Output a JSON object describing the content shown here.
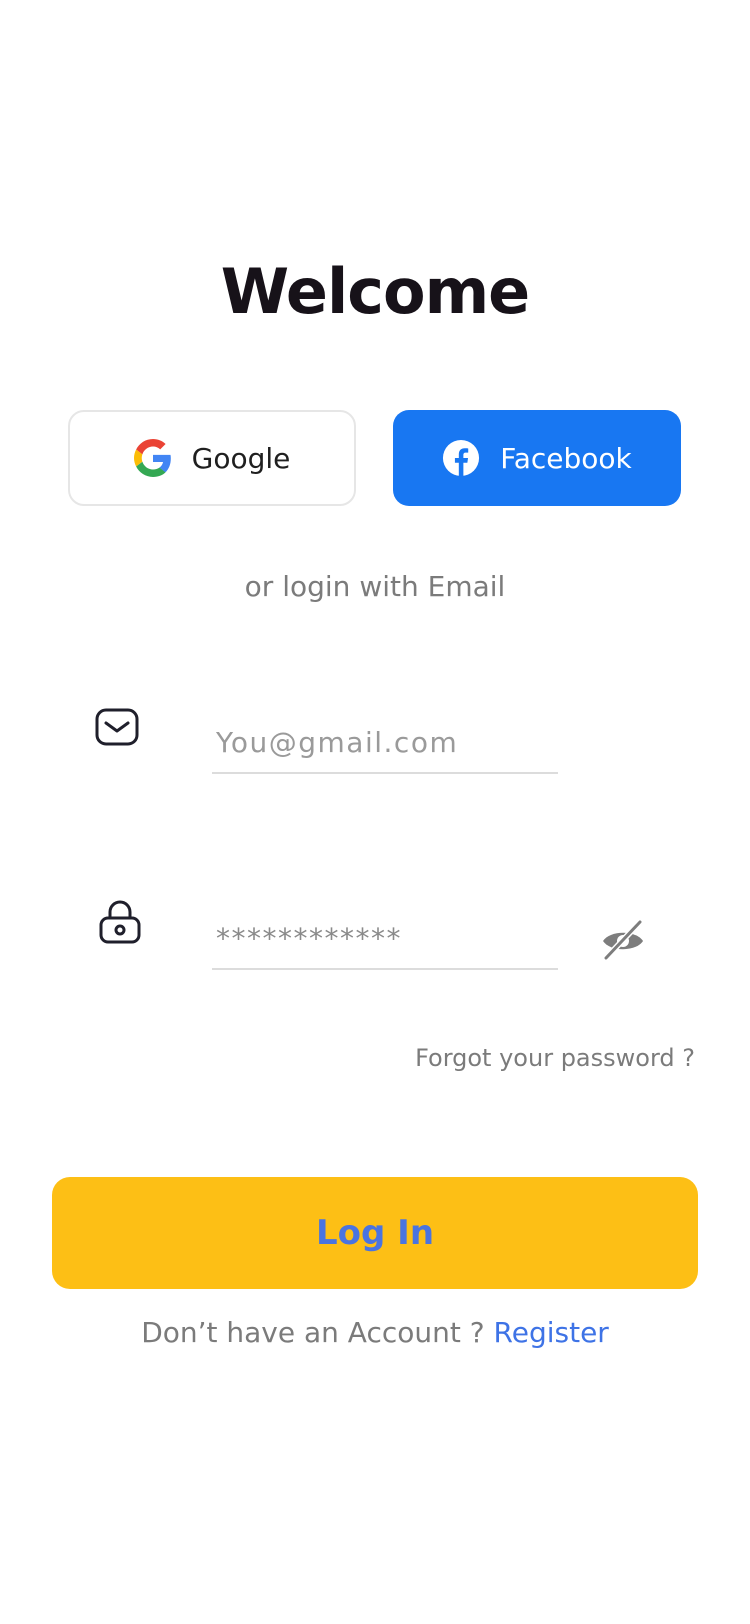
{
  "header": {
    "title": "Welcome"
  },
  "social": {
    "google_label": "Google",
    "facebook_label": "Facebook"
  },
  "divider_text": "or login with Email",
  "email": {
    "value": "",
    "placeholder": "You@gmail.com",
    "icon": "mail-icon"
  },
  "password": {
    "value": "************",
    "placeholder": "",
    "icon": "lock-icon",
    "visibility_icon": "eye-off-icon"
  },
  "forgot_label": "Forgot your password ?",
  "login_label": "Log In",
  "register": {
    "prompt": "Don’t have an Account ?",
    "link_label": "Register"
  },
  "colors": {
    "facebook_blue": "#1877f2",
    "login_yellow": "#fdbf15",
    "login_text": "#4a74e0",
    "register_link": "#3e73e6"
  }
}
